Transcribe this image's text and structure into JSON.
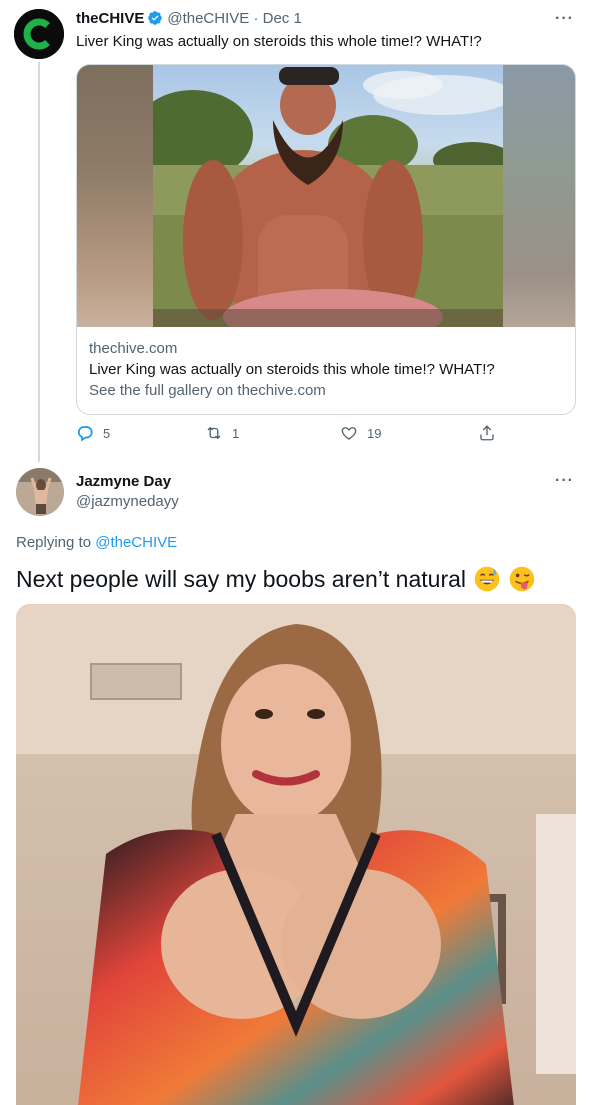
{
  "tweet1": {
    "author_name": "theCHIVE",
    "author_handle": "@theCHIVE",
    "separator": "·",
    "date": "Dec 1",
    "more": "···",
    "text": "Liver King was actually on steroids this whole time!? WHAT!?",
    "card": {
      "domain": "thechive.com",
      "title": "Liver King was actually on steroids this whole time!? WHAT!?",
      "description": "See the full gallery on thechive.com"
    },
    "actions": {
      "replies": "5",
      "retweets": "1",
      "likes": "19"
    }
  },
  "tweet2": {
    "author_name": "Jazmyne Day",
    "author_handle": "@jazmynedayy",
    "more": "···",
    "replying_prefix": "Replying to",
    "replying_mention": "@theCHIVE",
    "text": "Next people will say my boobs aren’t natural"
  },
  "colors": {
    "text_primary": "#0f1419",
    "text_secondary": "#536471",
    "link": "#1d9bf0",
    "border": "#cfd9de",
    "chive_green": "#1fb24a"
  }
}
